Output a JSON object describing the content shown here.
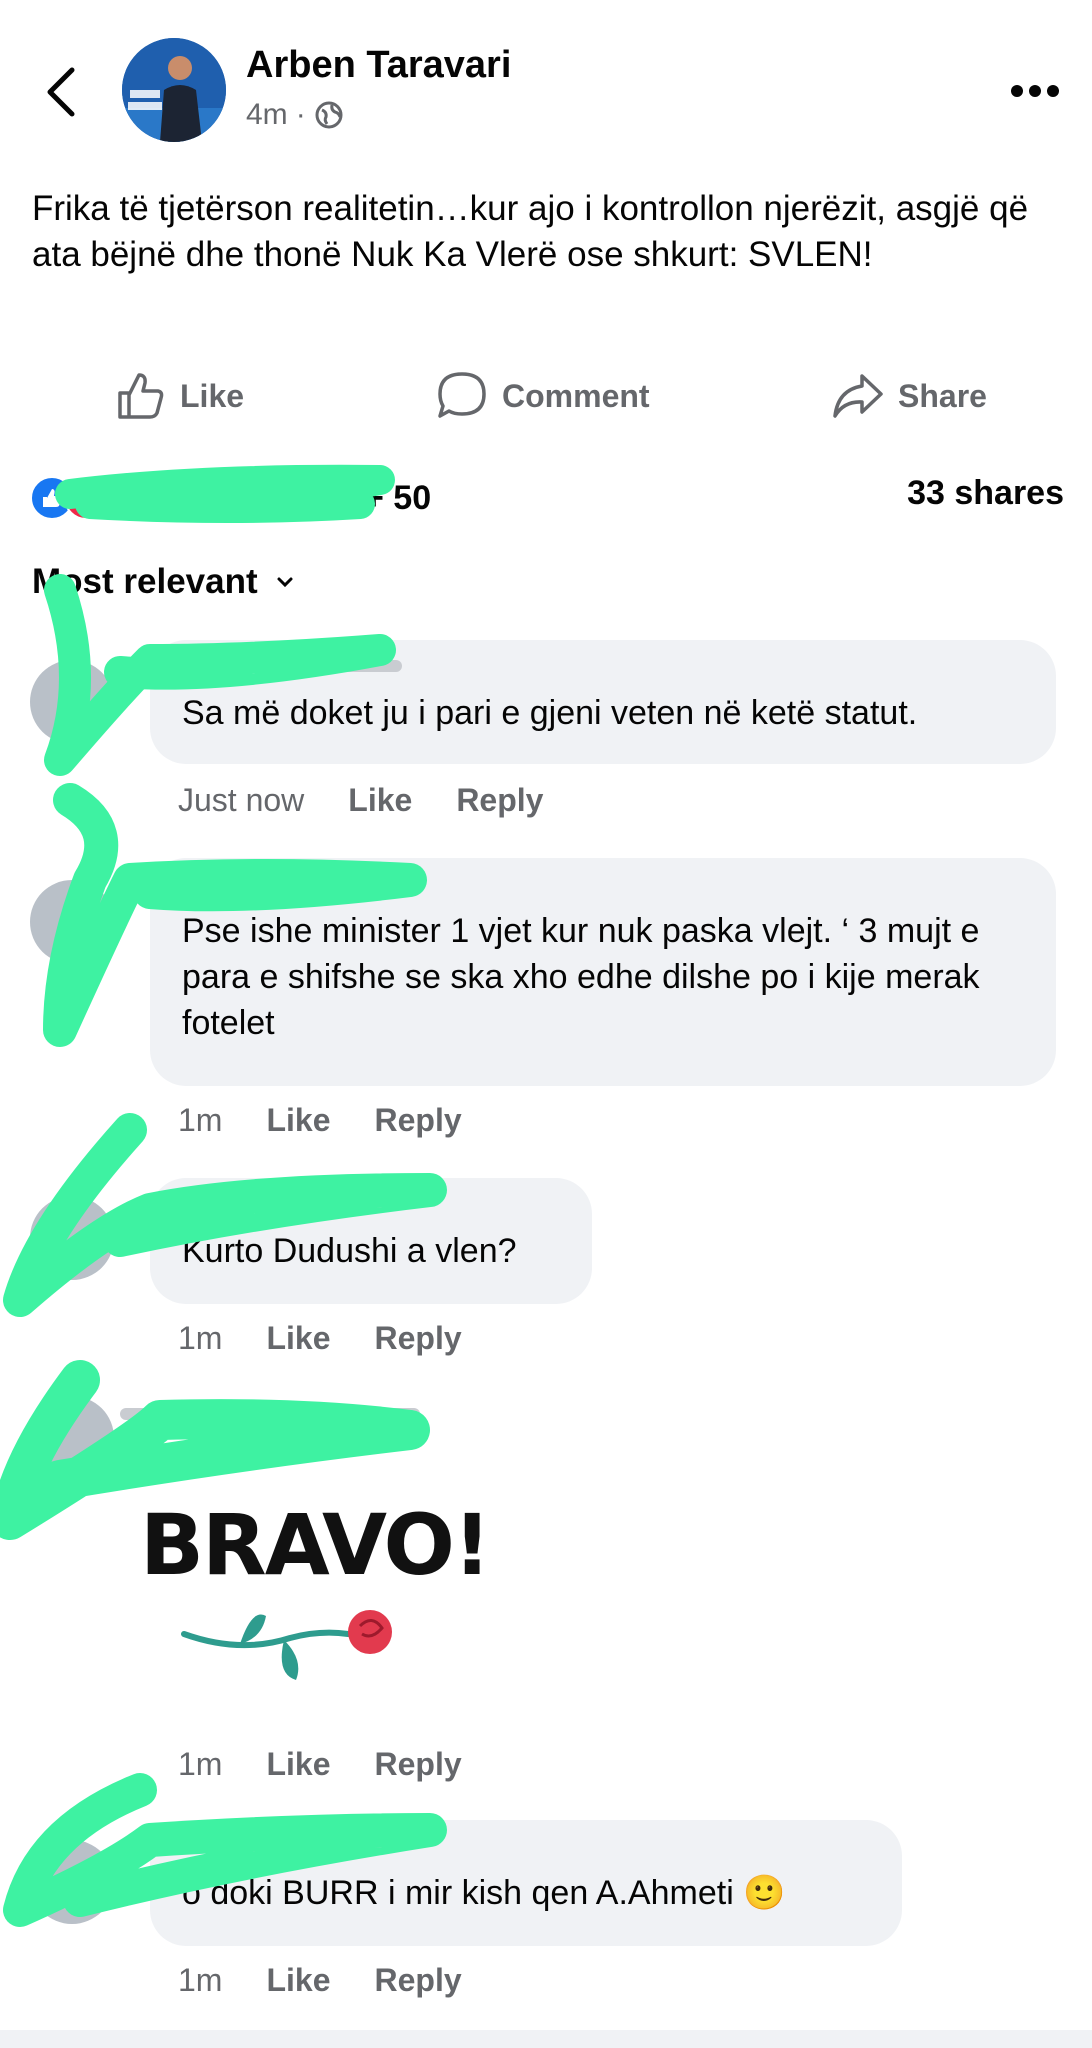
{
  "post": {
    "author": "Arben Taravari",
    "time": "4m",
    "separator": "·",
    "text": "Frika të tjetërson realitetin…kur ajo i kontrollon njerëzit, asgjë që ata bëjnë dhe thonë Nuk Ka Vlerë ose shkurt: SVLEN!"
  },
  "actions": {
    "like": "Like",
    "comment": "Comment",
    "share": "Share"
  },
  "reactions": {
    "more": "+ 50",
    "shares": "33 shares"
  },
  "sort": {
    "label": "Most relevant"
  },
  "comments": [
    {
      "text": "Sa më doket ju i pari e gjeni veten në ketë statut.",
      "time": "Just now",
      "like": "Like",
      "reply": "Reply"
    },
    {
      "text": "Pse ishe minister 1 vjet kur nuk paska vlejt. ‘ 3 mujt e para e shifshe se ska xho edhe dilshe po i kije merak fotelet",
      "time": "1m",
      "like": "Like",
      "reply": "Reply"
    },
    {
      "text": "Kurto Dudushi a vlen?",
      "time": "1m",
      "like": "Like",
      "reply": "Reply"
    },
    {
      "sticker_text": "BRAVO!",
      "time": "1m",
      "like": "Like",
      "reply": "Reply"
    },
    {
      "text": "o doki BURR i mir kish qen A.Ahmeti 🙂",
      "time": "1m",
      "like": "Like",
      "reply": "Reply"
    }
  ],
  "colors": {
    "accent": "#1877f2",
    "redaction": "#3ef2a2",
    "bubble": "#f0f2f5",
    "muted": "#65676b"
  },
  "icons": [
    "back-chevron-icon",
    "globe-icon",
    "more-dots-icon",
    "thumbs-up-icon",
    "comment-icon",
    "share-icon",
    "chevron-down-icon",
    "rose-icon"
  ]
}
